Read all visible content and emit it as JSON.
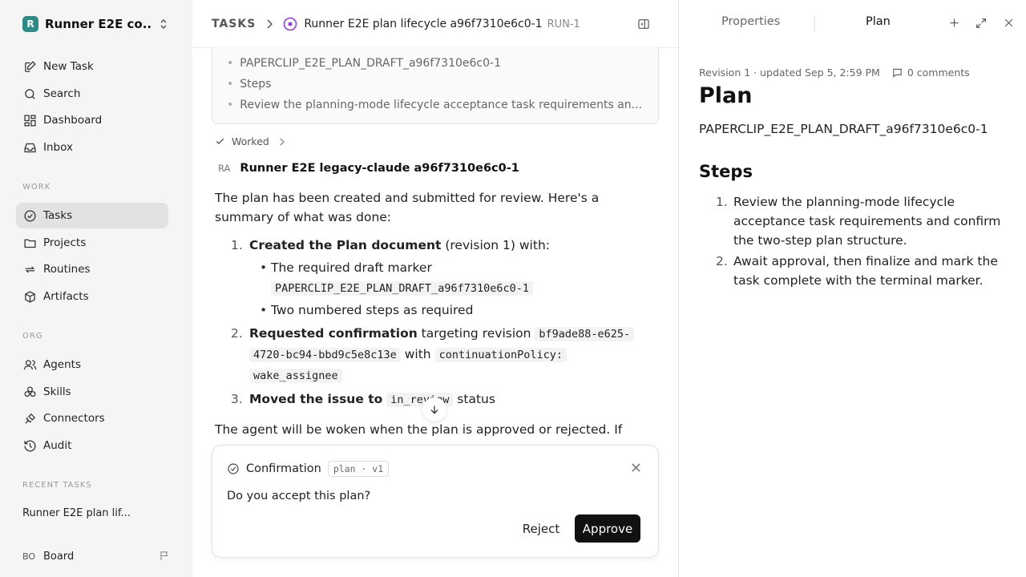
{
  "sidebar": {
    "workspace_initial": "R",
    "workspace_name": "Runner E2E co...",
    "nav_top": [
      {
        "label": "New Task",
        "icon": "edit-icon"
      },
      {
        "label": "Search",
        "icon": "search-icon"
      },
      {
        "label": "Dashboard",
        "icon": "dashboard-icon"
      },
      {
        "label": "Inbox",
        "icon": "inbox-icon"
      }
    ],
    "work_section": "WORK",
    "nav_work": [
      {
        "label": "Tasks",
        "icon": "check-circle-icon",
        "active": true
      },
      {
        "label": "Projects",
        "icon": "folder-icon"
      },
      {
        "label": "Routines",
        "icon": "repeat-icon"
      },
      {
        "label": "Artifacts",
        "icon": "box-icon"
      }
    ],
    "org_section": "ORG",
    "nav_org": [
      {
        "label": "Agents",
        "icon": "users-icon"
      },
      {
        "label": "Skills",
        "icon": "skills-icon"
      },
      {
        "label": "Connectors",
        "icon": "plug-icon"
      },
      {
        "label": "Audit",
        "icon": "history-icon"
      }
    ],
    "recent_section": "RECENT TASKS",
    "recent_item": "Runner E2E plan lif...",
    "board_initials": "BO",
    "board_label": "Board"
  },
  "header": {
    "section": "TASKS",
    "task_title": "Runner E2E plan lifecycle a96f7310e6c0-1",
    "run_id": "RUN-1"
  },
  "draft_preview": {
    "items": [
      "PAPERCLIP_E2E_PLAN_DRAFT_a96f7310e6c0-1",
      "Steps",
      "Review the planning-mode lifecycle acceptance task requirements an..."
    ]
  },
  "activity": {
    "worked_label": "Worked",
    "author_initials": "RA",
    "author_name": "Runner E2E legacy-claude a96f7310e6c0-1",
    "intro": "The plan has been created and submitted for review. Here's a summary of what was done:",
    "item1_bold": "Created the Plan document",
    "item1_rest": " (revision 1) with:",
    "item1_sub1": "The required draft marker",
    "item1_sub1_code": "PAPERCLIP_E2E_PLAN_DRAFT_a96f7310e6c0-1",
    "item1_sub2": "Two numbered steps as required",
    "item2_bold": "Requested confirmation",
    "item2_text": " targeting revision ",
    "item2_code1a": "bf9ade88-e625-",
    "item2_code1b": "4720-bc94-bbd9c5e8c13e",
    "item2_with": " with ",
    "item2_code2a": "continuationPolicy:",
    "item2_code2b": "wake_assignee",
    "item3_bold": "Moved the issue to",
    "item3_code": "in_review",
    "item3_rest": " status",
    "outro": "The agent will be woken when the plan is approved or rejected. If"
  },
  "confirmation": {
    "title": "Confirmation",
    "badge": "plan · v1",
    "question": "Do you accept this plan?",
    "reject_label": "Reject",
    "approve_label": "Approve"
  },
  "panel": {
    "tab_properties": "Properties",
    "tab_plan": "Plan",
    "meta": "Revision 1 · updated Sep 5, 2:59 PM",
    "comments": "0 comments",
    "heading": "Plan",
    "marker": "PAPERCLIP_E2E_PLAN_DRAFT_a96f7310e6c0-1",
    "steps_heading": "Steps",
    "steps": [
      {
        "n": "1.",
        "text": "Review the planning-mode lifecycle acceptance task requirements and confirm the two-step plan structure."
      },
      {
        "n": "2.",
        "text": "Await approval, then finalize and mark the task complete with the terminal marker."
      }
    ]
  }
}
